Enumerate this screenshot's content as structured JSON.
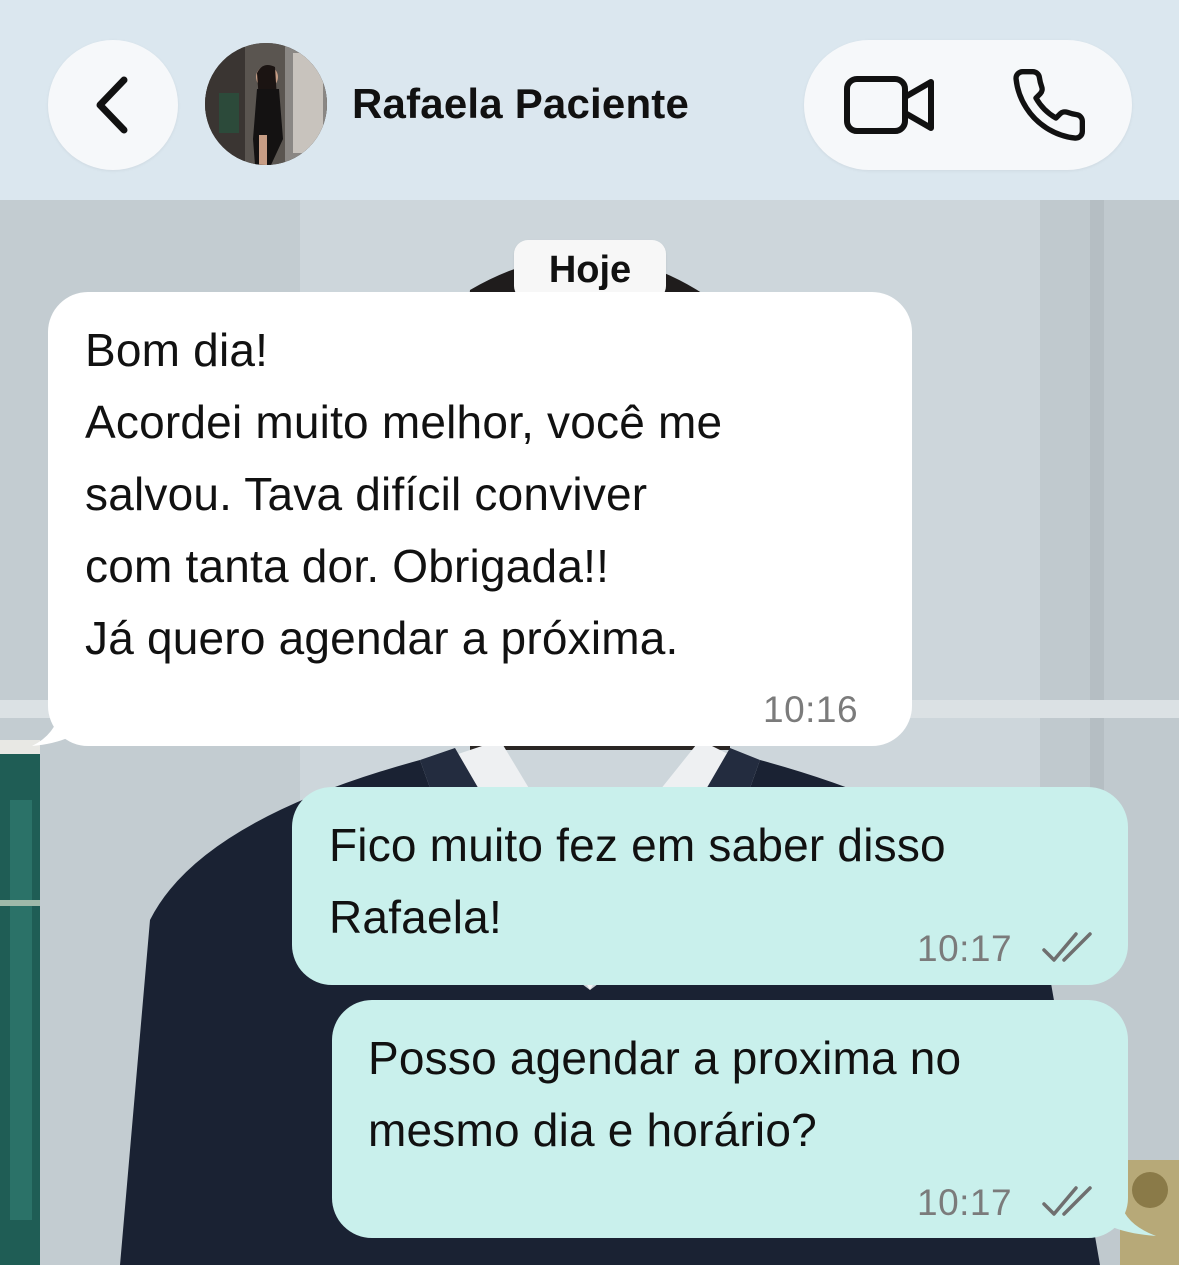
{
  "header": {
    "contact_name": "Rafaela Paciente",
    "back_icon": "chevron-left-icon",
    "video_icon": "video-camera-icon",
    "phone_icon": "phone-icon"
  },
  "chat": {
    "date_label": "Hoje",
    "messages": [
      {
        "direction": "incoming",
        "lines": [
          "Bom dia!",
          "Acordei muito melhor, você me",
          "salvou. Tava difícil conviver",
          "com tanta dor. Obrigada!!",
          "Já quero agendar a próxima."
        ],
        "time": "10:16"
      },
      {
        "direction": "outgoing",
        "lines": [
          "Fico muito fez em saber disso",
          "Rafaela!"
        ],
        "time": "10:17",
        "status_icon": "double-check-icon"
      },
      {
        "direction": "outgoing",
        "lines": [
          "Posso agendar a proxima no",
          "mesmo dia e horário?"
        ],
        "time": "10:17",
        "status_icon": "double-check-icon"
      }
    ]
  },
  "colors": {
    "header_bg": "#dbe7ef",
    "incoming_bubble": "#ffffff",
    "outgoing_bubble": "#c9f0ec",
    "timestamp": "#7b7b7b"
  }
}
